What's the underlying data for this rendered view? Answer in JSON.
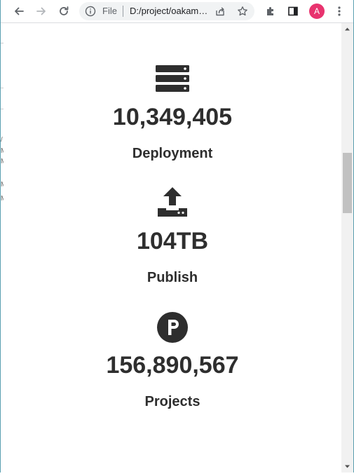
{
  "browser": {
    "scheme_label": "File",
    "url": "D:/project/oakamee/index.html",
    "profile_initial": "A"
  },
  "stats": [
    {
      "icon": "server-icon",
      "value": "10,349,405",
      "label": "Deployment"
    },
    {
      "icon": "upload-icon",
      "value": "104TB",
      "label": "Publish"
    },
    {
      "icon": "p-circle-icon",
      "value": "156,890,567",
      "label": "Projects"
    }
  ],
  "left_strip_glyphs": [
    "/",
    "M",
    "M",
    "M",
    "M"
  ],
  "colors": {
    "text": "#2e2e2e",
    "avatar": "#e8336e",
    "frame": "#5a9fb0"
  }
}
